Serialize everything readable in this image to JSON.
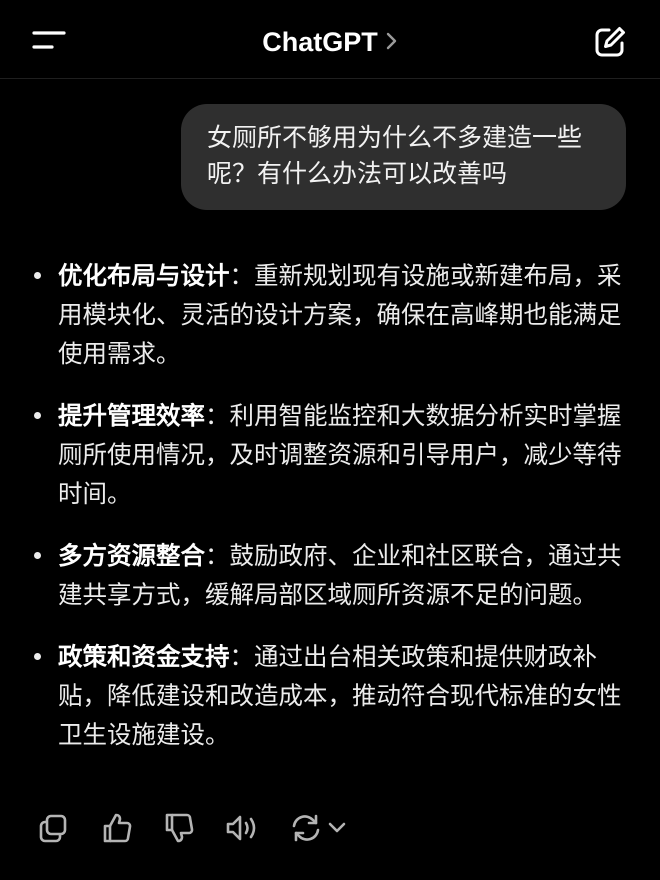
{
  "header": {
    "title": "ChatGPT",
    "menu_icon": "menu-icon",
    "chevron_icon": "chevron-right-icon",
    "new_chat_icon": "edit-icon"
  },
  "user_message": {
    "text": "女厕所不够用为什么不多建造一些呢？有什么办法可以改善吗"
  },
  "assistant_message": {
    "items": [
      {
        "term": "优化布局与设计",
        "sep": "：",
        "text": "重新规划现有设施或新建布局，采用模块化、灵活的设计方案，确保在高峰期也能满足使用需求。"
      },
      {
        "term": "提升管理效率",
        "sep": "：",
        "text": "利用智能监控和大数据分析实时掌握厕所使用情况，及时调整资源和引导用户，减少等待时间。"
      },
      {
        "term": "多方资源整合",
        "sep": "：",
        "text": "鼓励政府、企业和社区联合，通过共建共享方式，缓解局部区域厕所资源不足的问题。"
      },
      {
        "term": "政策和资金支持",
        "sep": "：",
        "text": "通过出台相关政策和提供财政补贴，降低建设和改造成本，推动符合现代标准的女性卫生设施建设。"
      }
    ]
  },
  "action_bar": {
    "icons": [
      "copy-icon",
      "thumbs-up-icon",
      "thumbs-down-icon",
      "read-aloud-icon",
      "regenerate-icon",
      "chevron-down-icon"
    ]
  },
  "colors": {
    "background": "#000000",
    "bubble": "#2f2f2f",
    "text": "#ececec",
    "icon": "#b4b4b4"
  }
}
